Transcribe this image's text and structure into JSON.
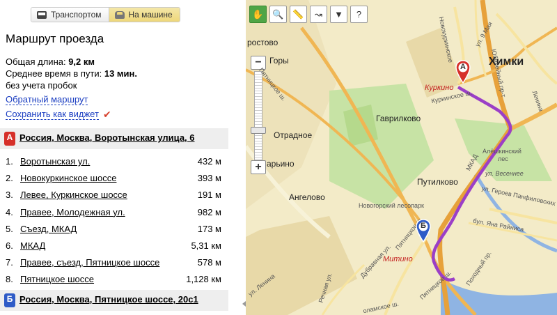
{
  "modes": {
    "transit_label": "Транспортом",
    "car_label": "На машине"
  },
  "panel": {
    "title": "Маршрут проезда",
    "length_label": "Общая длина: ",
    "length_value": "9,2 км",
    "time_label": "Среднее время в пути: ",
    "time_value": "13 мин.",
    "traffic_note": "без учета пробок",
    "reverse_link": "Обратный маршрут",
    "widget_link": "Сохранить как виджет"
  },
  "start": {
    "marker": "А",
    "address": "Россия, Москва, Воротынская улица, 6"
  },
  "end": {
    "marker": "Б",
    "address": "Россия, Москва, Пятницкое шоссе, 20с1"
  },
  "steps": [
    {
      "num": "1.",
      "street": "Воротынская ул.",
      "dist": "432 м"
    },
    {
      "num": "2.",
      "street": "Новокуркинское шоссе",
      "dist": "393 м"
    },
    {
      "num": "3.",
      "street": "Левее, Куркинское шоссе",
      "dist": "191 м"
    },
    {
      "num": "4.",
      "street": "Правее, Молодежная ул.",
      "dist": "982 м"
    },
    {
      "num": "5.",
      "street": "Съезд, МКАД",
      "dist": "173 м"
    },
    {
      "num": "6.",
      "street": "МКАД",
      "dist": "5,31 км"
    },
    {
      "num": "7.",
      "street": "Правее, съезд, Пятницкое шоссе",
      "dist": "578 м"
    },
    {
      "num": "8.",
      "street": "Пятницкое шоссе",
      "dist": "1,128 км"
    }
  ],
  "map": {
    "markers": {
      "a": "А",
      "b": "Б"
    },
    "labels": {
      "khimki": "Химки",
      "kurkino": "Куркино",
      "kurkinskoe": "Куркинское ш.",
      "gavrilkovo": "Гаврилково",
      "otradnoe": "Отрадное",
      "putilkovo": "Путилково",
      "angelovo": "Ангелово",
      "lesopark": "Новогорский лесопарк",
      "mitino": "Митино",
      "aleshkinsky": "Алёшкинский",
      "les": "лес",
      "vesennee": "ул. Весеннее",
      "mkad": "МКАД",
      "pyatnitskoe": "Пятницкое ш.",
      "pyatnitskoe2": "Пятницкое ш.",
      "dubravnaya": "Дубравная ул.",
      "geroev": "ул. Героев Панфиловских",
      "rainisa": "бул. Яна Райниса",
      "pokhodny": "Походный пр.",
      "rechnaya": "Речная ул.",
      "lenina": "ул. Ленина",
      "lenina2": "Ленина",
      "novokurk": "Новокуркинское",
      "yubil": "Юбилейный пр-т",
      "ul9maya": "ул. 9 Мая",
      "gory": "Горы",
      "rostovo": "ростово",
      "arino": "арьино",
      "volokolam": "оламское ш.",
      "pyat3": "Пятницкое ш."
    },
    "colors": {
      "route": "#9b3fc7",
      "mkad": "#e7a13a",
      "water": "#8fb4e3",
      "forest": "#c7e3a5"
    }
  }
}
